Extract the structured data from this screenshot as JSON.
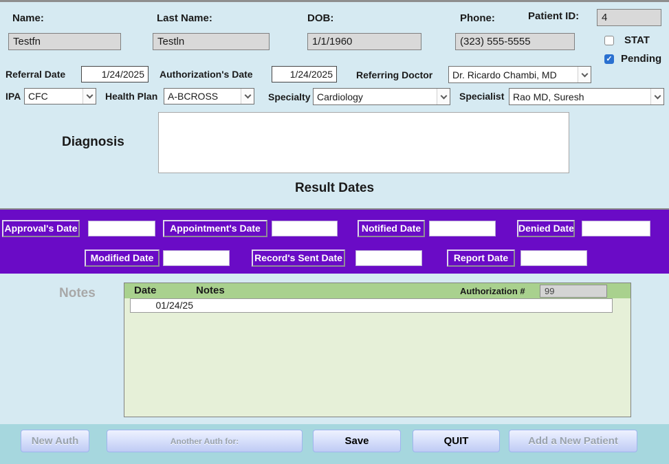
{
  "patient": {
    "name_label": "Name:",
    "name_value": "Testfn",
    "last_name_label": "Last Name:",
    "last_name_value": "Testln",
    "dob_label": "DOB:",
    "dob_value": "1/1/1960",
    "phone_label": "Phone:",
    "phone_value": "(323) 555-5555",
    "patient_id_label": "Patient ID:",
    "patient_id_value": "4",
    "stat_label": "STAT",
    "pending_label": "Pending",
    "pending_check": "✓"
  },
  "referral": {
    "referral_date_label": "Referral Date",
    "referral_date_value": "1/24/2025",
    "authorization_date_label": "Authorization's Date",
    "authorization_date_value": "1/24/2025",
    "referring_doctor_label": "Referring Doctor",
    "referring_doctor_value": "Dr. Ricardo Chambi, MD",
    "ipa_label": "IPA",
    "ipa_value": "CFC",
    "health_plan_label": "Health Plan",
    "health_plan_value": "A-BCROSS",
    "specialty_label": "Specialty",
    "specialty_value": "Cardiology",
    "specialist_label": "Specialist",
    "specialist_value": "Rao MD, Suresh",
    "diagnosis_label": "Diagnosis",
    "diagnosis_value": ""
  },
  "result_dates": {
    "heading": "Result Dates",
    "fields": [
      {
        "label": "Approval's Date",
        "value": ""
      },
      {
        "label": "Appointment's Date",
        "value": ""
      },
      {
        "label": "Notified Date",
        "value": ""
      },
      {
        "label": "Denied Date",
        "value": ""
      },
      {
        "label": "Modified Date",
        "value": ""
      },
      {
        "label": "Record's Sent Date",
        "value": ""
      },
      {
        "label": "Report Date",
        "value": ""
      }
    ]
  },
  "notes": {
    "section_label": "Notes",
    "date_header": "Date",
    "notes_header": "Notes",
    "authorization_label": "Authorization #",
    "authorization_value": "99",
    "rows": [
      {
        "date": "01/24/25",
        "note": ""
      }
    ]
  },
  "buttons": {
    "new_auth": "New Auth",
    "another_auth": "Another Auth for:",
    "save": "Save",
    "quit": "QUIT",
    "add_patient": "Add a New Patient"
  },
  "colors": {
    "background": "#d6eaf2",
    "purple_band": "#6a0bc6",
    "notes_panel": "#e6f0d8",
    "notes_header_band": "#a9d18e",
    "bottom_bar": "#a6d7de",
    "pending_checkbox": "#2a70d0",
    "field_gray": "#d9d9d9"
  }
}
